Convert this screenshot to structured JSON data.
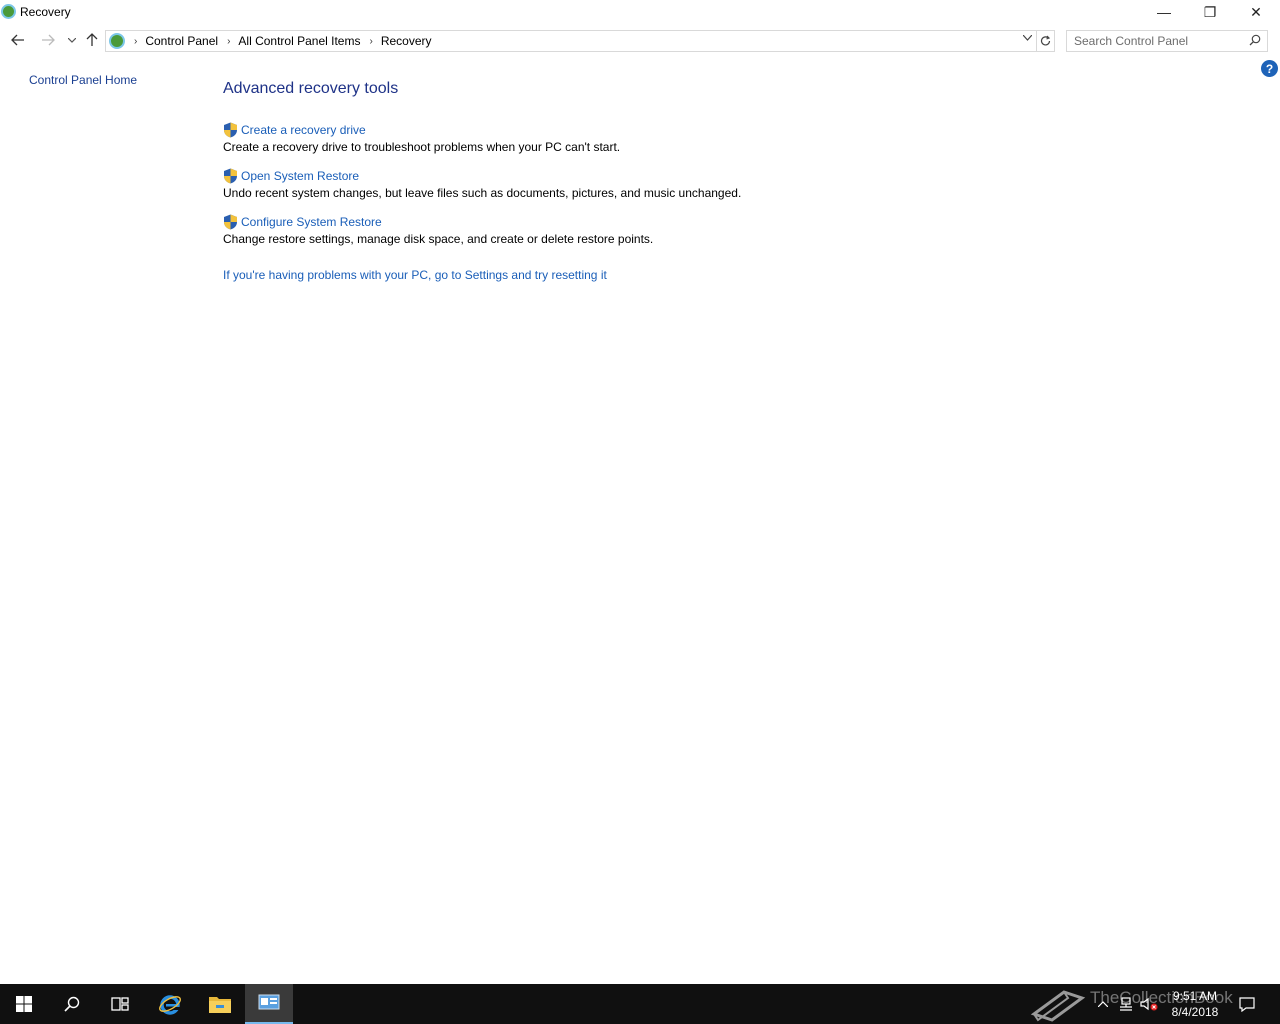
{
  "window": {
    "title": "Recovery",
    "minimize_glyph": "—",
    "maximize_glyph": "❐",
    "close_glyph": "✕"
  },
  "nav": {
    "breadcrumbs": [
      "Control Panel",
      "All Control Panel Items",
      "Recovery"
    ],
    "search_placeholder": "Search Control Panel"
  },
  "left_pane": {
    "home_link": "Control Panel Home"
  },
  "main": {
    "heading": "Advanced recovery tools",
    "tools": [
      {
        "label": "Create a recovery drive",
        "description": "Create a recovery drive to troubleshoot problems when your PC can't start."
      },
      {
        "label": "Open System Restore",
        "description": "Undo recent system changes, but leave files such as documents, pictures, and music unchanged."
      },
      {
        "label": "Configure System Restore",
        "description": "Change restore settings, manage disk space, and create or delete restore points."
      }
    ],
    "reset_link": "If you're having problems with your PC, go to Settings and try resetting it"
  },
  "help": {
    "glyph": "?"
  },
  "taskbar": {
    "time": "9:51 AM",
    "date": "8/4/2018",
    "watermark": "TheCollectionBook"
  },
  "icons": {
    "title": "control-panel-icon",
    "back": "back-arrow-icon",
    "forward": "forward-arrow-icon",
    "up": "up-arrow-icon",
    "refresh": "refresh-icon",
    "search": "search-icon",
    "shield": "uac-shield-icon"
  }
}
